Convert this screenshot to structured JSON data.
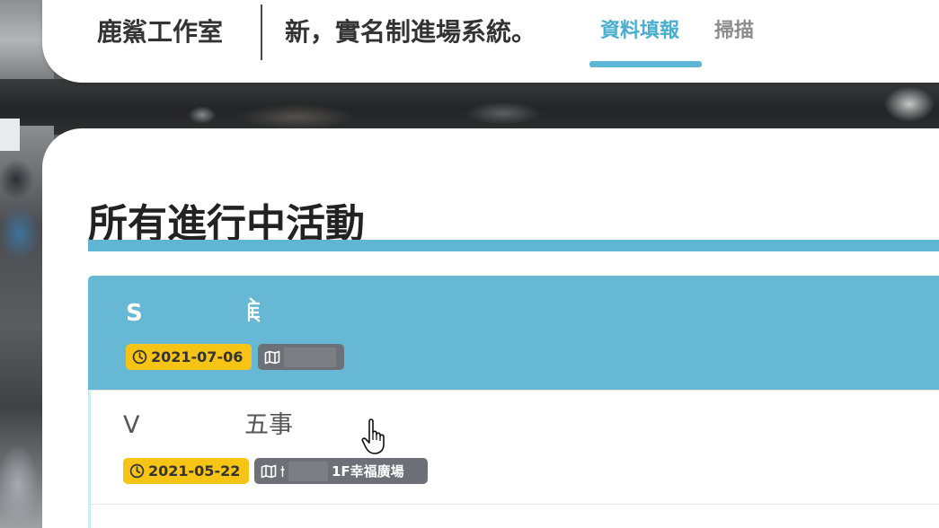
{
  "header": {
    "brand": "鹿鯊工作室",
    "subtitle": "新，實名制進場系統。",
    "tabs": [
      {
        "label": "資料填報",
        "active": true
      },
      {
        "label": "掃描",
        "active": false
      }
    ]
  },
  "main": {
    "heading": "所有進行中活動",
    "events": [
      {
        "title_start": "S",
        "date": "2021-07-06",
        "selected": true
      },
      {
        "title_start": "V",
        "title_end": "五事",
        "date": "2021-05-22",
        "location": "1F幸福廣場",
        "selected": false
      }
    ]
  },
  "icons": {
    "date": "clock-icon",
    "location": "map-icon",
    "pointer": "hand-pointer-icon"
  },
  "colors": {
    "accent": "#5bb5d4",
    "tab_active": "#4aaed0",
    "tab_inactive": "#8c8c8c",
    "selected_row": "#67b8d5",
    "date_badge": "#f6c415",
    "location_badge": "#6d7177"
  }
}
